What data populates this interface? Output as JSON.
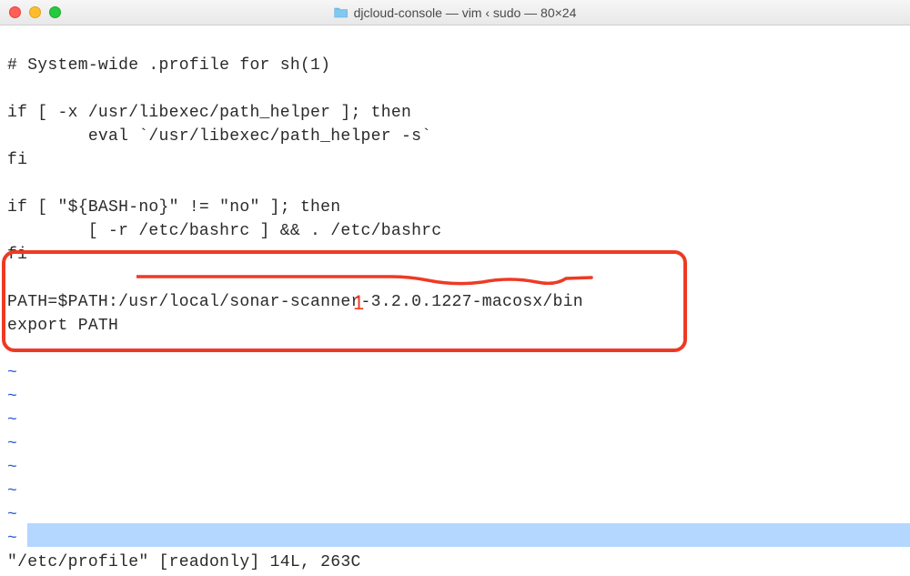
{
  "window": {
    "title": "djcloud-console — vim ‹ sudo — 80×24"
  },
  "lines": {
    "l1": "# System-wide .profile for sh(1)",
    "l2": "",
    "l3": "if [ -x /usr/libexec/path_helper ]; then",
    "l4": "        eval `/usr/libexec/path_helper -s`",
    "l5": "fi",
    "l6": "",
    "l7": "if [ \"${BASH-no}\" != \"no\" ]; then",
    "l8": "        [ -r /etc/bashrc ] && . /etc/bashrc",
    "l9": "fi",
    "l10": "",
    "l11": "PATH=$PATH:/usr/local/sonar-scanner-3.2.0.1227-macosx/bin",
    "l12": "export PATH",
    "tilde": "~"
  },
  "annotation": {
    "label": "1"
  },
  "status": {
    "text": "\"/etc/profile\" [readonly] 14L, 263C"
  }
}
